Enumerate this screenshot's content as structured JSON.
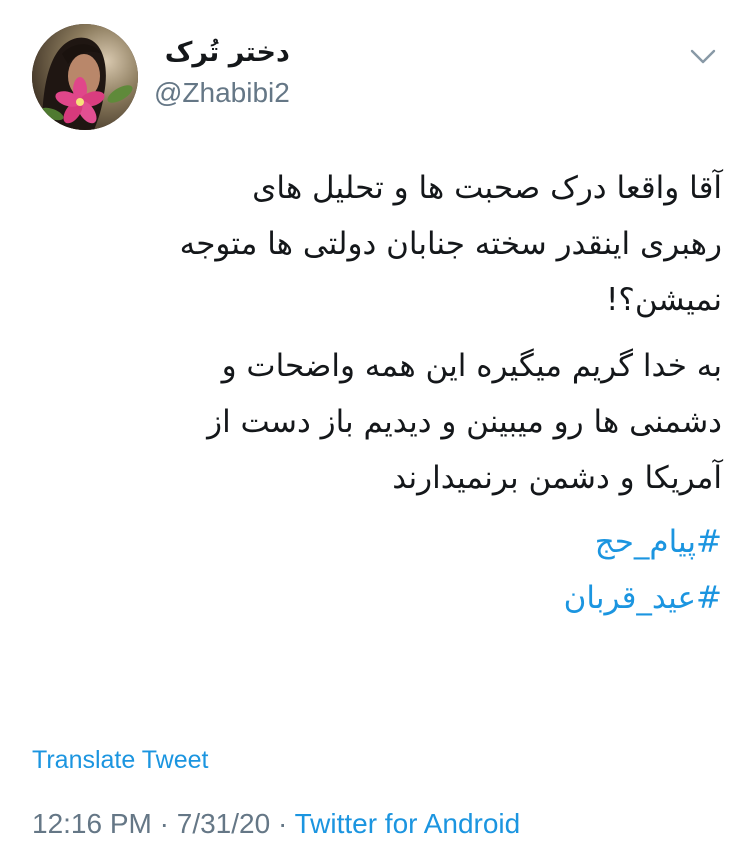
{
  "user": {
    "display_name": "دختر تُرک",
    "handle": "@Zhabibi2"
  },
  "tweet": {
    "paragraphs": [
      {
        "lines": [
          "آقا واقعا درک صحبت ها و تحلیل های",
          "رهبری اینقدر سخته جنابان دولتی ها متوجه",
          "نمیشن؟!"
        ]
      },
      {
        "lines": [
          "به خدا گریم میگیره این همه واضحات و",
          "دشمنی ها رو میبینن و دیدیم باز دست از",
          "آمریکا و دشمن برنمیدارند"
        ]
      }
    ],
    "hashtags": [
      "#پیام_حج",
      "#عید_قربان"
    ],
    "translate_label": "Translate Tweet",
    "time": "12:16 PM",
    "date": "7/31/20",
    "separator": "·",
    "source": "Twitter for Android"
  },
  "icons": {
    "caret": "chevron-down-icon"
  },
  "colors": {
    "link": "#1b95e0",
    "secondary": "#657786",
    "text": "#14171a"
  }
}
